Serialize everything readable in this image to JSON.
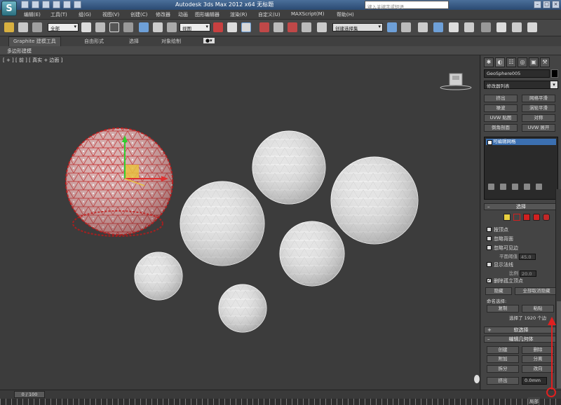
{
  "window": {
    "title": "Autodesk 3ds Max  2012 x64     无标题",
    "logo_letter": "S",
    "search_placeholder": "键入关键字或短语"
  },
  "menu": [
    "编辑(E)",
    "工具(T)",
    "组(G)",
    "视图(V)",
    "创建(C)",
    "修改器",
    "动画",
    "图形编辑器",
    "渲染(R)",
    "自定义(U)",
    "MAXScript(M)",
    "帮助(H)"
  ],
  "toolbar": {
    "filter_combo": "全部",
    "coord_combo": "视图",
    "selection_set": "创建选择集"
  },
  "ribbon": {
    "tabs": [
      "Graphite 建模工具",
      "自由形式",
      "选择",
      "对象绘制"
    ],
    "active_tab": "Graphite 建模工具",
    "sub_label": "多边形建模"
  },
  "viewport": {
    "label": "[ + ] [ 前 ] [ 真实 + 边面 ]"
  },
  "command_panel": {
    "object_name": "GeoSphere005",
    "modifier_list": "修改器列表",
    "modifier_buttons": [
      "挤出",
      "网格平滑",
      "噪波",
      "涡轮平滑",
      "UVW 贴图",
      "对称",
      "倒角剖面",
      "UVW 展开"
    ],
    "stack_item": "可编辑网格",
    "selection_rollout": "选择",
    "by_vertex": "按顶点",
    "ignore_backfacing": "忽略背面",
    "ignore_visible_edges": "忽略可见边",
    "planar_threshold_label": "平面阈值",
    "planar_threshold_value": "45.0",
    "show_normals": "显示法线",
    "scale_label": "比例",
    "scale_value": "20.0",
    "delete_isolated": "删除孤立顶点",
    "hide_button": "隐藏",
    "unhide_all_button": "全部取消隐藏",
    "named_selections": "命名选择:",
    "copy_button": "复制",
    "paste_button": "粘贴",
    "selection_status": "选择了 1920 个边",
    "soft_selection": "软选择",
    "edit_geometry": "编辑几何体",
    "create_button": "创建",
    "delete_button": "删除",
    "attach_button": "附加",
    "detach_button": "分离",
    "break_button": "拆分",
    "turn_button": "改向",
    "extrude_button": "挤出",
    "extrude_value": "0.0mm"
  },
  "timeline": {
    "slider": "0 / 100",
    "right_label": "局部"
  },
  "colors": {
    "accent": "#3b6fb0",
    "selected_red": "#d01818",
    "annotation_red": "#e02020",
    "sphere_white": "#e6e6e6"
  }
}
